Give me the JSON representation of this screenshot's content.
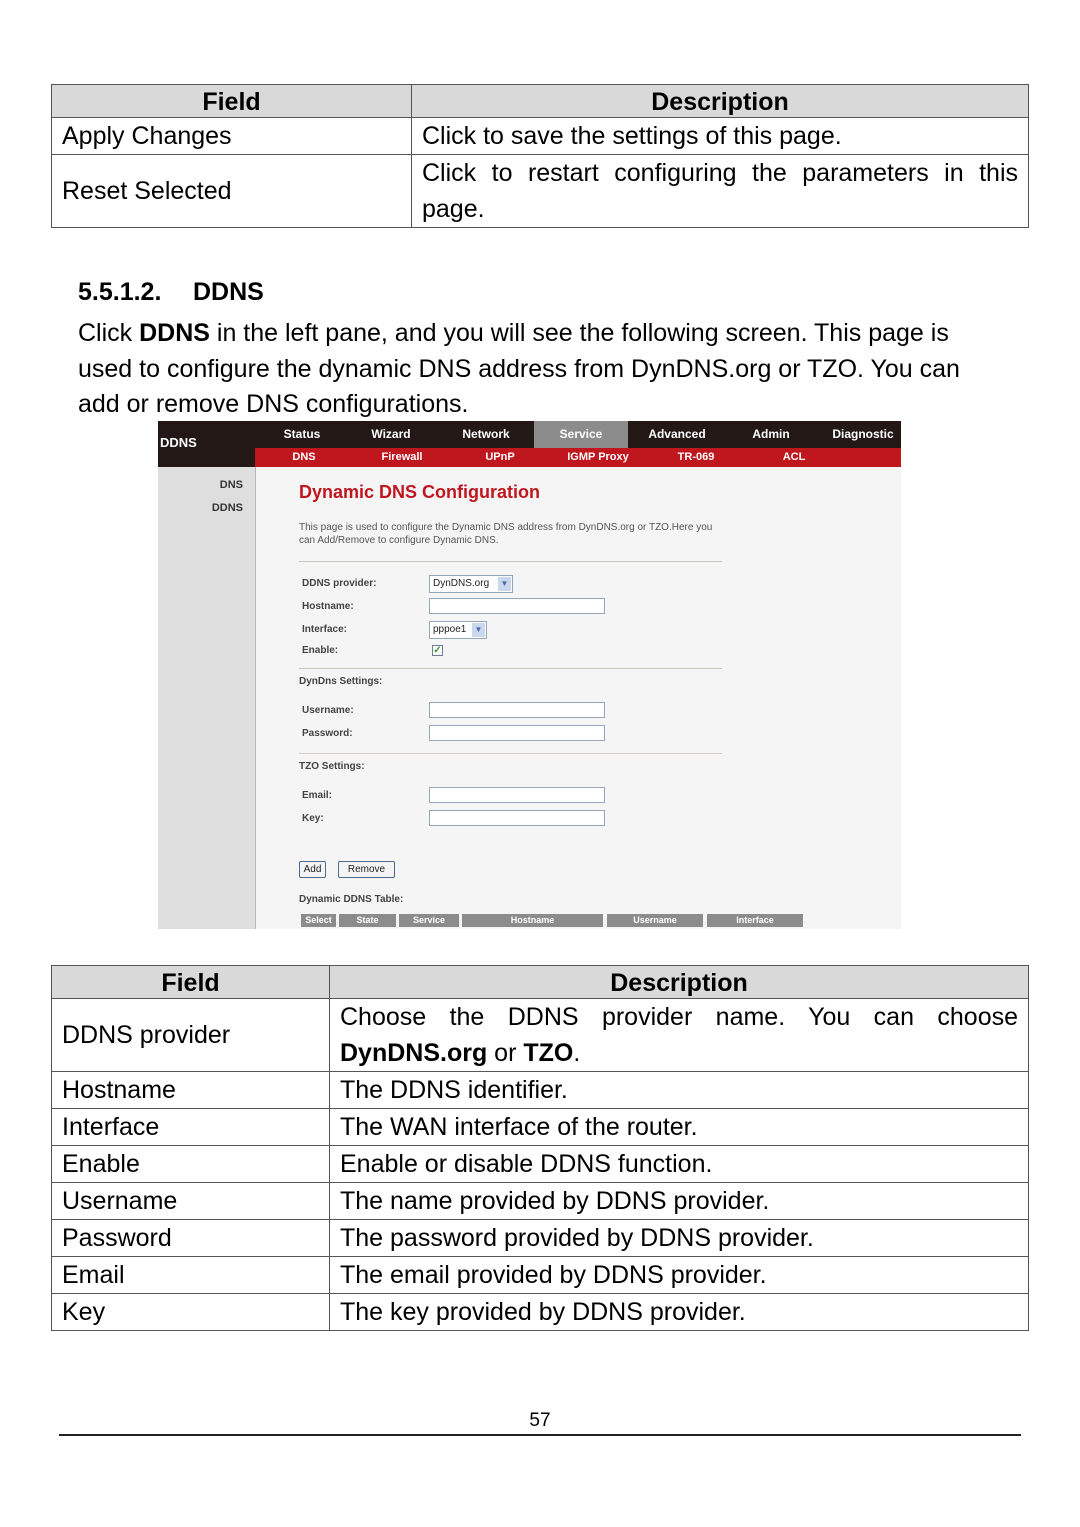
{
  "table1": {
    "headers": [
      "Field",
      "Description"
    ],
    "rows": [
      {
        "field": "Apply Changes",
        "description": "Click to save the settings of this page."
      },
      {
        "field": "Reset Selected",
        "description": "Click to restart configuring the parameters in this page."
      }
    ]
  },
  "section": {
    "number": "5.5.1.2.",
    "title": "DDNS",
    "para_prefix": "Click ",
    "para_bold": "DDNS",
    "para_rest": " in the left pane, and you will see the following screen. This page is used to configure the dynamic DNS address from DynDNS.org or TZO. You can add or remove  DNS configurations."
  },
  "screenshot": {
    "brand": "DDNS",
    "main_tabs": [
      {
        "label": "Status",
        "active": false
      },
      {
        "label": "Wizard",
        "active": false
      },
      {
        "label": "Network",
        "active": false
      },
      {
        "label": "Service",
        "active": true
      },
      {
        "label": "Advanced",
        "active": false
      },
      {
        "label": "Admin",
        "active": false
      },
      {
        "label": "Diagnostic",
        "active": false
      }
    ],
    "sub_tabs": [
      "DNS",
      "Firewall",
      "UPnP",
      "IGMP Proxy",
      "TR-069",
      "ACL"
    ],
    "sidebar": [
      "DNS",
      "DDNS"
    ],
    "title": "Dynamic DNS Configuration",
    "intro": "This page is used to configure the Dynamic DNS address from DynDNS.org or TZO.Here you can Add/Remove to configure Dynamic DNS.",
    "form": {
      "provider_label": "DDNS provider:",
      "provider_value": "DynDNS.org",
      "hostname_label": "Hostname:",
      "hostname_value": "",
      "interface_label": "Interface:",
      "interface_value": "pppoe1",
      "enable_label": "Enable:",
      "enable_checked": true,
      "dyndns_section": "DynDns Settings:",
      "username_label": "Username:",
      "username_value": "",
      "password_label": "Password:",
      "password_value": "",
      "tzo_section": "TZO Settings:",
      "email_label": "Email:",
      "email_value": "",
      "key_label": "Key:",
      "key_value": ""
    },
    "buttons": {
      "add": "Add",
      "remove": "Remove"
    },
    "table_title": "Dynamic DDNS Table:",
    "table_headers": [
      "Select",
      "State",
      "Service",
      "Hostname",
      "Username",
      "Interface"
    ],
    "colors": {
      "topbar": "#231815",
      "subbar": "#c0161e",
      "title": "#c0161e",
      "active_tab": "#8c8c8c"
    }
  },
  "table2": {
    "headers": [
      "Field",
      "Description"
    ],
    "rows": [
      {
        "field": "DDNS provider",
        "description_prefix": "Choose the DDNS provider name. You can choose ",
        "bold1": "DynDNS.org",
        "mid": " or ",
        "bold2": "TZO",
        "suffix": "."
      },
      {
        "field": "Hostname",
        "description": "The DDNS identifier."
      },
      {
        "field": "Interface",
        "description": "The WAN interface of the router."
      },
      {
        "field": "Enable",
        "description": "Enable or disable DDNS function."
      },
      {
        "field": "Username",
        "description": "The name provided by DDNS provider."
      },
      {
        "field": "Password",
        "description": "The password provided by DDNS provider."
      },
      {
        "field": "Email",
        "description": "The email provided by DDNS provider."
      },
      {
        "field": "Key",
        "description": "The key provided by DDNS provider."
      }
    ]
  },
  "footer": {
    "page_number": "57"
  }
}
